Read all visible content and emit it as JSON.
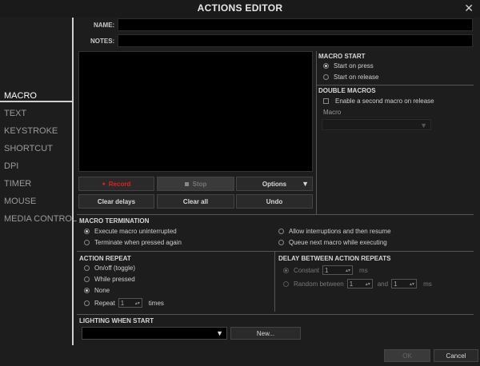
{
  "window": {
    "title": "ACTIONS EDITOR",
    "close_glyph": "✕"
  },
  "sidebar": {
    "items": [
      {
        "label": "MACRO",
        "active": true
      },
      {
        "label": "TEXT"
      },
      {
        "label": "KEYSTROKE"
      },
      {
        "label": "SHORTCUT"
      },
      {
        "label": "DPI"
      },
      {
        "label": "TIMER"
      },
      {
        "label": "MOUSE"
      },
      {
        "label": "MEDIA CONTROL"
      }
    ]
  },
  "form": {
    "name_label": "NAME:",
    "name_value": "",
    "notes_label": "NOTES:",
    "notes_value": ""
  },
  "macro_buttons": {
    "record": "Record",
    "stop": "Stop",
    "options": "Options",
    "clear_delays": "Clear delays",
    "clear_all": "Clear all",
    "undo": "Undo"
  },
  "macro_start": {
    "title": "MACRO START",
    "options": [
      "Start on press",
      "Start on release"
    ],
    "selected": 0
  },
  "double_macros": {
    "title": "DOUBLE MACROS",
    "checkbox_label": "Enable a second macro on release",
    "macro_label": "Macro",
    "macro_value": ""
  },
  "macro_termination": {
    "title": "MACRO TERMINATION",
    "options": [
      "Execute macro uninterrupted",
      "Terminate when pressed again",
      "Allow interruptions and then resume",
      "Queue next macro while executing"
    ],
    "selected": 0
  },
  "action_repeat": {
    "title": "ACTION REPEAT",
    "options": [
      "On/off (toggle)",
      "While pressed",
      "None",
      "Repeat"
    ],
    "selected": 2,
    "repeat_value": "1",
    "times_label": "times"
  },
  "delay_repeats": {
    "title": "DELAY BETWEEN ACTION REPEATS",
    "constant_label": "Constant",
    "constant_value": "1",
    "ms_label": "ms",
    "random_label": "Random between",
    "random_min": "1",
    "and_label": "and",
    "random_max": "1"
  },
  "lighting": {
    "title": "LIGHTING WHEN START",
    "select_value": "",
    "new_button": "New..."
  },
  "footer": {
    "ok": "OK",
    "cancel": "Cancel"
  },
  "colors": {
    "accent": "#e02020",
    "background": "#1d1d1d"
  }
}
